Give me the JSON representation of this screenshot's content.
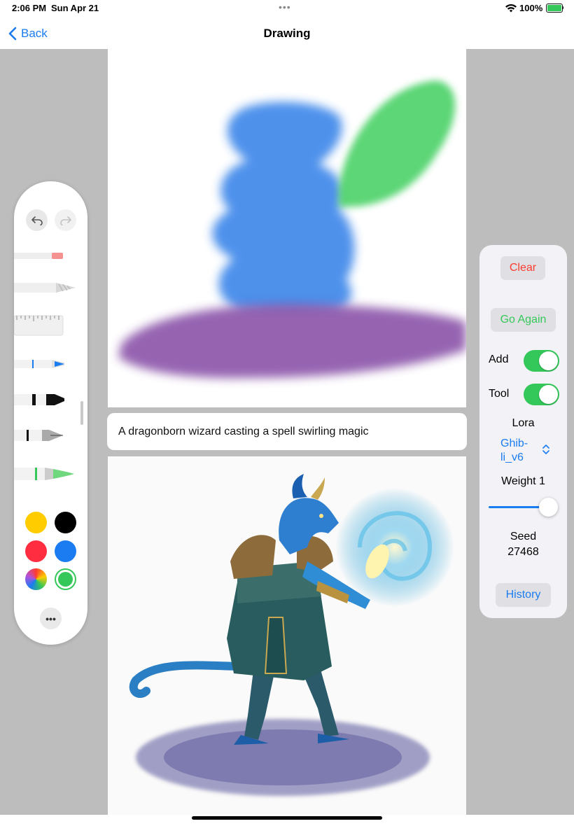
{
  "status": {
    "time": "2:06 PM",
    "date": "Sun Apr 21",
    "dots": "•••",
    "battery": "100%"
  },
  "nav": {
    "back_label": "Back",
    "title": "Drawing"
  },
  "prompt": {
    "text": "A dragonborn wizard casting a spell swirling magic"
  },
  "palette": {
    "colors": [
      "#ffcc00",
      "#000000",
      "#ff2d3f",
      "#1a7cf0",
      "spectrum",
      "#34c759"
    ],
    "selected_color": "#34c759"
  },
  "panel": {
    "clear_label": "Clear",
    "go_again_label": "Go Again",
    "add_label": "Add",
    "add_on": true,
    "tool_label": "Tool",
    "tool_on": true,
    "lora_label": "Lora",
    "lora_value_line1": "Ghib-",
    "lora_value_line2": "li_v6",
    "weight_label": "Weight 1",
    "weight_value": 1,
    "seed_label": "Seed",
    "seed_value": "27468",
    "history_label": "History"
  },
  "colors": {
    "accent": "#1a7cf0",
    "destructive": "#ff3b30",
    "success": "#34c759"
  }
}
